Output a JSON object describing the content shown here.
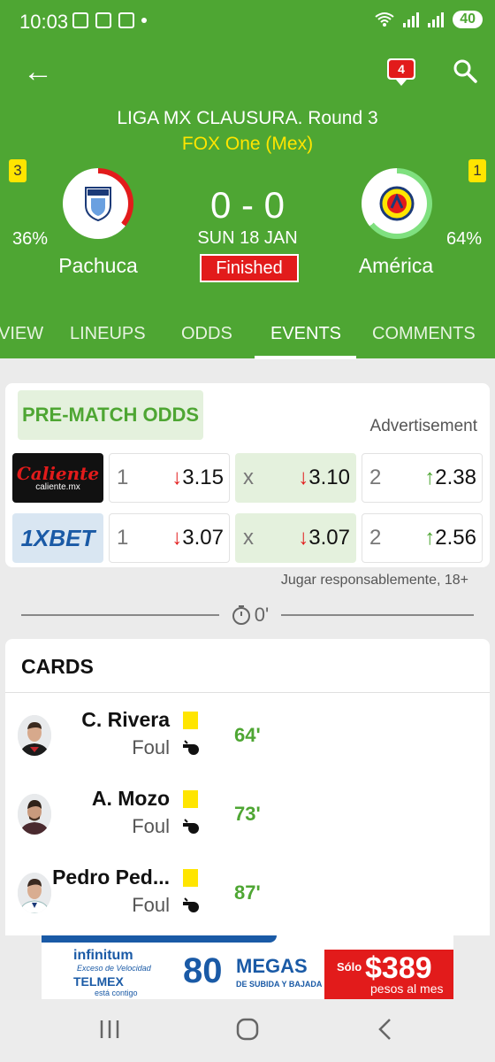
{
  "status_bar": {
    "time": "10:03",
    "battery": "40"
  },
  "header": {
    "chat_count": "4",
    "league": "LIGA MX CLAUSURA.  Round 3",
    "broadcast": "FOX One (Mex)",
    "home": {
      "name": "Pachuca",
      "possession": "36%",
      "cards": "3"
    },
    "away": {
      "name": "América",
      "possession": "64%",
      "cards": "1"
    },
    "score": "0 - 0",
    "date": "SUN 18 JAN",
    "status": "Finished"
  },
  "tabs": [
    "VIEW",
    "LINEUPS",
    "ODDS",
    "EVENTS",
    "COMMENTS"
  ],
  "active_tab": "EVENTS",
  "odds": {
    "title": "PRE-MATCH ODDS",
    "advertisement": "Advertisement",
    "rows": [
      {
        "bookmaker": "Caliente",
        "bookmaker_sub": "caliente.mx",
        "home": {
          "label": "1",
          "value": "3.15",
          "trend": "down",
          "arrow": "↓"
        },
        "draw": {
          "label": "x",
          "value": "3.10",
          "trend": "down",
          "arrow": "↓"
        },
        "away": {
          "label": "2",
          "value": "2.38",
          "trend": "up",
          "arrow": "↑"
        }
      },
      {
        "bookmaker": "1XBET",
        "bookmaker_sub": "",
        "home": {
          "label": "1",
          "value": "3.07",
          "trend": "down",
          "arrow": "↓"
        },
        "draw": {
          "label": "x",
          "value": "3.07",
          "trend": "down",
          "arrow": "↓"
        },
        "away": {
          "label": "2",
          "value": "2.56",
          "trend": "up",
          "arrow": "↑"
        }
      }
    ],
    "disclaimer": "Jugar responsablemente, 18+"
  },
  "timeline": {
    "minute": "0'"
  },
  "cards_section": {
    "title": "CARDS",
    "entries": [
      {
        "player": "C. Rivera",
        "reason": "Foul",
        "minute": "64'"
      },
      {
        "player": "A. Mozo",
        "reason": "Foul",
        "minute": "73'"
      },
      {
        "player": "Pedro Ped...",
        "reason": "Foul",
        "minute": "87'"
      }
    ]
  },
  "banner_ad": {
    "brand": "infinitum",
    "brand_tag": "Exceso de Velocidad",
    "brand2": "TELMEX",
    "brand2_tag": "está contigo",
    "amount": "80",
    "unit": "MEGAS",
    "unit_sub": "DE SUBIDA Y BAJADA",
    "prefix": "Sólo",
    "price": "$389",
    "period": "pesos al mes"
  },
  "colors": {
    "primary_green": "#4ea633",
    "accent_yellow": "#ffe500",
    "alert_red": "#e21b1b"
  }
}
